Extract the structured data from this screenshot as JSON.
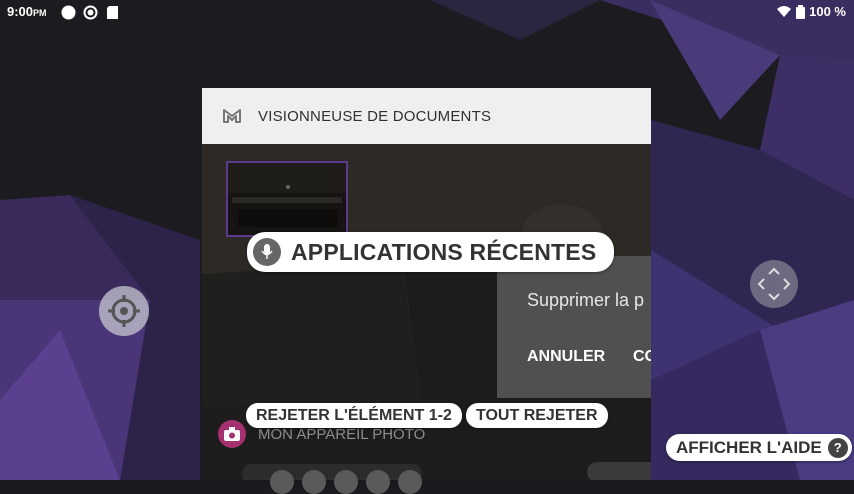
{
  "status_bar": {
    "time": "9:00",
    "ampm": "PM",
    "battery": "100 %"
  },
  "recent_card": {
    "title": "VISIONNEUSE DE DOCUMENTS",
    "dialog": {
      "message": "Supprimer la p",
      "cancel": "ANNULER",
      "confirm": "CO"
    },
    "footer_app": "MON APPAREIL PHOTO"
  },
  "overlay": {
    "title": "APPLICATIONS RÉCENTES",
    "dismiss_item": "REJETER L'ÉLÉMENT 1-2",
    "dismiss_all": "TOUT REJETER",
    "help": "AFFICHER L'AIDE",
    "help_badge": "?"
  },
  "colors": {
    "accent_purple": "#5b3a8d",
    "camera_icon": "#a4306f",
    "dialog_bg": "#505050"
  }
}
